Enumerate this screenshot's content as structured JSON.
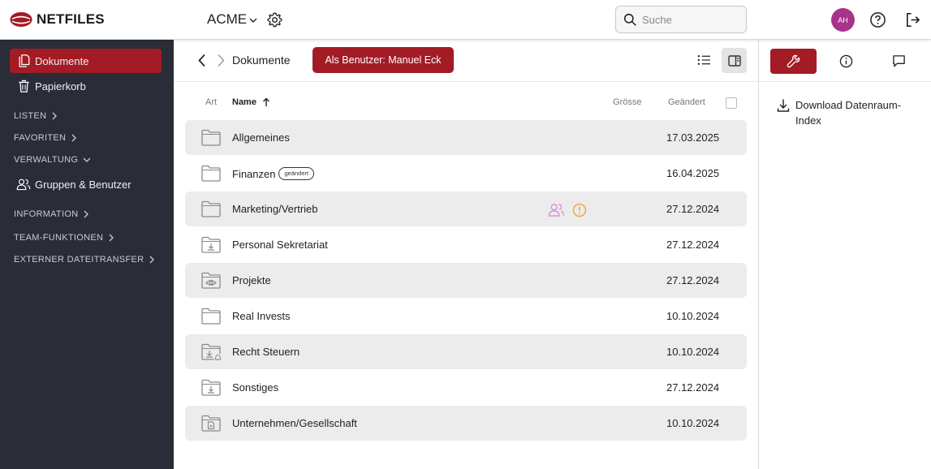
{
  "app": {
    "logo_text": "NETFILES",
    "tenant": "ACME",
    "brand_color": "#a31b25"
  },
  "header": {
    "search_placeholder": "Suche",
    "avatar_initials": "AH"
  },
  "sidebar": {
    "items": [
      {
        "label": "Dokumente",
        "icon": "documents-icon",
        "active": true
      },
      {
        "label": "Papierkorb",
        "icon": "trash-icon",
        "active": false
      }
    ],
    "sections": {
      "listen": "LISTEN",
      "favoriten": "FAVORITEN",
      "verwaltung": "VERWALTUNG",
      "information": "INFORMATION",
      "team": "TEAM-FUNKTIONEN",
      "transfer": "EXTERNER DATEITRANSFER"
    },
    "sub_items": {
      "groups_users": "Gruppen & Benutzer"
    }
  },
  "toolbar": {
    "breadcrumb": "Dokumente",
    "as_user_button": "Als Benutzer: Manuel Eck"
  },
  "table": {
    "headers": {
      "art": "Art",
      "name": "Name",
      "size": "Grösse",
      "date": "Geändert"
    },
    "rows": [
      {
        "name": "Allgemeines",
        "date": "17.03.2025",
        "icon": "folder-icon"
      },
      {
        "name": "Finanzen",
        "date": "16.04.2025",
        "icon": "folder-icon",
        "badge": "geändert"
      },
      {
        "name": "Marketing/Vertrieb",
        "date": "27.12.2024",
        "icon": "folder-icon",
        "indicators": [
          "users-icon",
          "warning-icon"
        ]
      },
      {
        "name": "Personal Sekretariat",
        "date": "27.12.2024",
        "icon": "folder-download-icon"
      },
      {
        "name": "Projekte",
        "date": "27.12.2024",
        "icon": "folder-eye-icon"
      },
      {
        "name": "Real Invests",
        "date": "10.10.2024",
        "icon": "folder-icon"
      },
      {
        "name": "Recht Steuern",
        "date": "10.10.2024",
        "icon": "folder-download-bell-icon"
      },
      {
        "name": "Sonstiges",
        "date": "27.12.2024",
        "icon": "folder-download-icon"
      },
      {
        "name": "Unternehmen/Gesellschaft",
        "date": "10.10.2024",
        "icon": "folder-document-icon"
      }
    ]
  },
  "right_panel": {
    "download_index": "Download Datenraum-Index"
  }
}
